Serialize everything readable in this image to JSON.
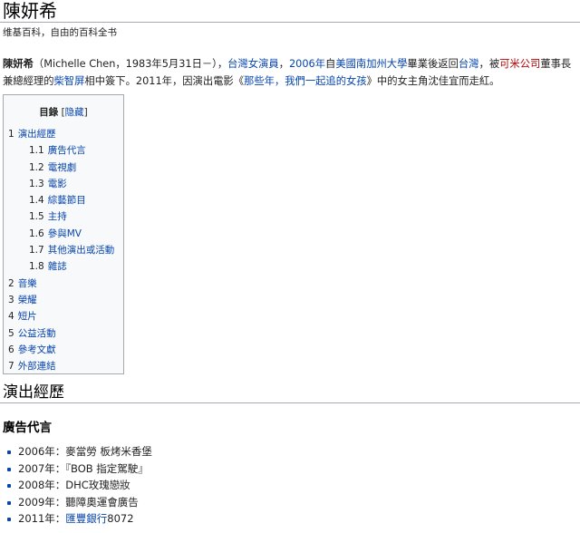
{
  "page_title": "陳妍希",
  "tagline": "维基百科，自由的百科全书",
  "lead": {
    "name": "陳妍希",
    "p1": "（Michelle Chen，1983年5月31日－），",
    "link_taiwan_actress": "台灣女演員",
    "p2": "，",
    "link_2006": "2006年",
    "p3": "自",
    "link_ucla": "美國南加州大學",
    "p4": "畢業後返回",
    "link_taiwan": "台灣",
    "p5": "，被",
    "link_comic": "可米公司",
    "p6": "董事長兼總經理的",
    "link_chai": "柴智屏",
    "p7": "相中簽下。2011年，因演出電影《",
    "link_film": "那些年，我們一起追的女孩",
    "p8": "》中的女主角沈佳宜而走紅。"
  },
  "toc": {
    "title": "目錄",
    "toggle": "隐藏",
    "items": [
      {
        "num": "1",
        "label": "演出經歷"
      },
      {
        "num": "1.1",
        "label": "廣告代言"
      },
      {
        "num": "1.2",
        "label": "電視劇"
      },
      {
        "num": "1.3",
        "label": "電影"
      },
      {
        "num": "1.4",
        "label": "綜藝節目"
      },
      {
        "num": "1.5",
        "label": "主持"
      },
      {
        "num": "1.6",
        "label": "參與MV"
      },
      {
        "num": "1.7",
        "label": "其他演出或活動"
      },
      {
        "num": "1.8",
        "label": "雜誌"
      },
      {
        "num": "2",
        "label": "音樂"
      },
      {
        "num": "3",
        "label": "榮耀"
      },
      {
        "num": "4",
        "label": "短片"
      },
      {
        "num": "5",
        "label": "公益活動"
      },
      {
        "num": "6",
        "label": "參考文獻"
      },
      {
        "num": "7",
        "label": "外部連結"
      }
    ]
  },
  "section_title": "演出經歷",
  "subsection_title": "廣告代言",
  "ads": [
    {
      "text": "2006年：麥當勞 板烤米香堡",
      "link": ""
    },
    {
      "text": "2007年：『BOB 指定駕駛』",
      "link": ""
    },
    {
      "text": "2008年：DHC玫瑰戀妝",
      "link": ""
    },
    {
      "text": "2009年：聽障奧運會廣告",
      "link": ""
    },
    {
      "text": "2011年：",
      "link": "匯豐銀行",
      "suffix": "8072"
    }
  ]
}
